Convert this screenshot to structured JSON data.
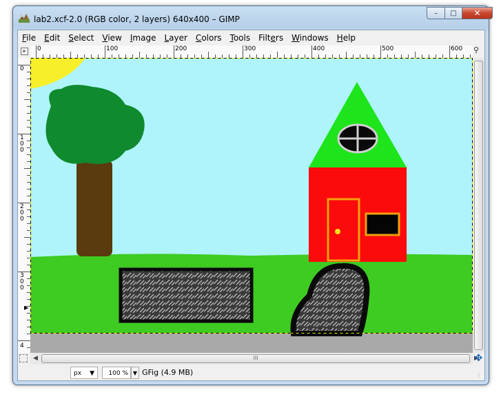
{
  "window": {
    "title": "lab2.xcf-2.0 (RGB color, 2 layers) 640x400 – GIMP",
    "app_icon": "gimp-icon",
    "close_glyph": "✕",
    "max_glyph": "□",
    "min_glyph": "–"
  },
  "menubar": [
    {
      "key": "F",
      "rest": "ile"
    },
    {
      "key": "E",
      "rest": "dit"
    },
    {
      "key": "S",
      "rest": "elect"
    },
    {
      "key": "V",
      "rest": "iew"
    },
    {
      "key": "I",
      "rest": "mage"
    },
    {
      "key": "L",
      "rest": "ayer"
    },
    {
      "key": "C",
      "rest": "olors"
    },
    {
      "key": "T",
      "rest": "ools"
    },
    {
      "key": "",
      "rest": "Filters",
      "underline_index": 4
    },
    {
      "key": "W",
      "rest": "indows"
    },
    {
      "key": "H",
      "rest": "elp"
    }
  ],
  "rulers": {
    "horizontal": [
      "0",
      "100",
      "200",
      "300",
      "400",
      "500",
      "600"
    ],
    "vertical": [
      "0",
      "100",
      "200",
      "300",
      "4"
    ]
  },
  "statusbar": {
    "unit": "px",
    "zoom": "100 %",
    "message": "GFig (4.9 MB)"
  },
  "scrollbar": {
    "grip": "III"
  },
  "colors": {
    "sky": "#aef4fa",
    "grass": "#3ecb22",
    "sun": "#f7ef2a",
    "tree_leaves": "#0f8a2e",
    "trunk": "#5a3b0e",
    "house_wall": "#fb0b0b",
    "roof": "#1ee41c",
    "door_outline": "#f2a10d",
    "window_fill": "#050505",
    "rock": "#3a3a3a"
  }
}
